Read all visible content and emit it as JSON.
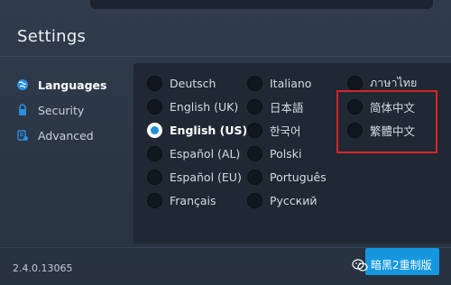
{
  "window": {
    "title": "Settings",
    "version": "2.4.0.13065"
  },
  "sidebar": {
    "items": [
      {
        "label": "Languages",
        "icon": "globe-icon",
        "active": true
      },
      {
        "label": "Security",
        "icon": "lock-icon",
        "active": false
      },
      {
        "label": "Advanced",
        "icon": "advanced-settings-icon",
        "active": false
      }
    ]
  },
  "languages": {
    "selected": "English (US)",
    "col1": [
      "Deutsch",
      "English (UK)",
      "English (US)",
      "Español (AL)",
      "Español (EU)",
      "Français"
    ],
    "col2": [
      "Italiano",
      "日本語",
      "한국어",
      "Polski",
      "Português",
      "Русский"
    ],
    "col3": [
      "ภาษาไทย",
      "简体中文",
      "繁體中文"
    ]
  },
  "watermark": {
    "text": "暗黑2重制版"
  },
  "colors": {
    "accent": "#1597e0",
    "highlight_border": "#d9232a",
    "panel": "#1f2833",
    "background": "#2a3544"
  }
}
